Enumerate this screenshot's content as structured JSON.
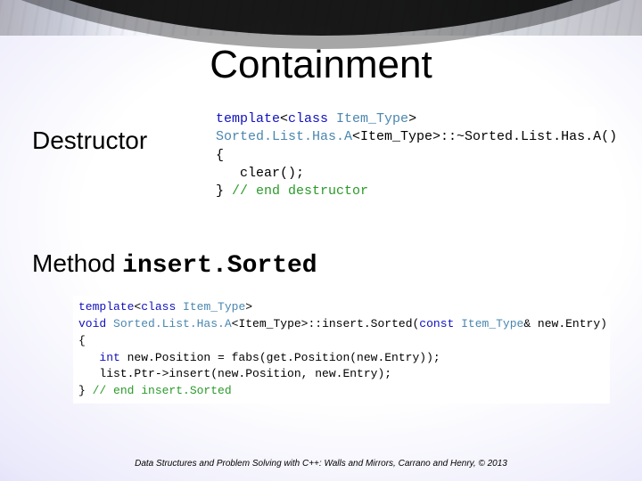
{
  "title": "Containment",
  "section1": {
    "label": "Destructor",
    "code": {
      "l1a": "template",
      "l1b": "<",
      "l1c": "class",
      "l1d": " Item_Type",
      "l1e": ">",
      "l2a": "Sorted.List.Has.A",
      "l2b": "<Item_Type>::~Sorted.List.Has.A()",
      "l3": "{",
      "l4": "   clear();",
      "l5a": "} ",
      "l5b": "// end destructor"
    }
  },
  "section2": {
    "label_prefix": "Method ",
    "method_name": "insert.Sorted",
    "code": {
      "l1a": "template",
      "l1b": "<",
      "l1c": "class",
      "l1d": " Item_Type",
      "l1e": ">",
      "l2a": "void",
      "l2b": " Sorted.List.Has.A",
      "l2c": "<Item_Type>::insert.Sorted(",
      "l2d": "const",
      "l2e": " Item_Type",
      "l2f": "& new.Entry)",
      "l3": "{",
      "l4a": "   ",
      "l4b": "int",
      "l4c": " new.Position = fabs(get.Position(new.Entry));",
      "l5": "   list.Ptr->insert(new.Position, new.Entry);",
      "l6a": "} ",
      "l6b": "// end insert.Sorted"
    }
  },
  "footer": "Data Structures and Problem Solving with C++: Walls and Mirrors, Carrano and Henry, ©  2013"
}
